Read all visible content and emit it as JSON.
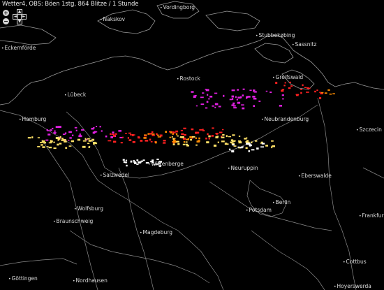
{
  "header": {
    "title": "Wetter4, OBS: Böen 1stg, 864 Blitze / 1 Stunde"
  },
  "controls": {
    "zoom_in": "+",
    "zoom_out": "−",
    "pan_up": "▲",
    "pan_down": "▼",
    "pan_left": "◄",
    "pan_right": "►"
  },
  "colors": {
    "land": "#000000",
    "border": "#8a8a8a",
    "coast": "#9a9a9a",
    "strike_newest": "#ffffff",
    "strike_recent": "#ffe066",
    "strike_mid": "#ff8c00",
    "strike_old": "#ff2020",
    "strike_oldest": "#e020e0"
  },
  "cities": [
    {
      "name": "Vordingborg"
    },
    {
      "name": "Nakskov"
    },
    {
      "name": "Eckernförde"
    },
    {
      "name": "Stubbekøbing"
    },
    {
      "name": "Sassnitz"
    },
    {
      "name": "Rostock"
    },
    {
      "name": "Greifswald"
    },
    {
      "name": "Lübeck"
    },
    {
      "name": "Hamburg"
    },
    {
      "name": "Neubrandenburg"
    },
    {
      "name": "Szczecin"
    },
    {
      "name": "Wittenberge"
    },
    {
      "name": "Salzwedel"
    },
    {
      "name": "Neuruppin"
    },
    {
      "name": "Eberswalde"
    },
    {
      "name": "Berlin"
    },
    {
      "name": "Potsdam"
    },
    {
      "name": "Wolfsburg"
    },
    {
      "name": "Braunschweig"
    },
    {
      "name": "Frankfurt"
    },
    {
      "name": "Magdeburg"
    },
    {
      "name": "Cottbus"
    },
    {
      "name": "Göttingen"
    },
    {
      "name": "Nordhausen"
    },
    {
      "name": "Hoyerswerda"
    }
  ]
}
